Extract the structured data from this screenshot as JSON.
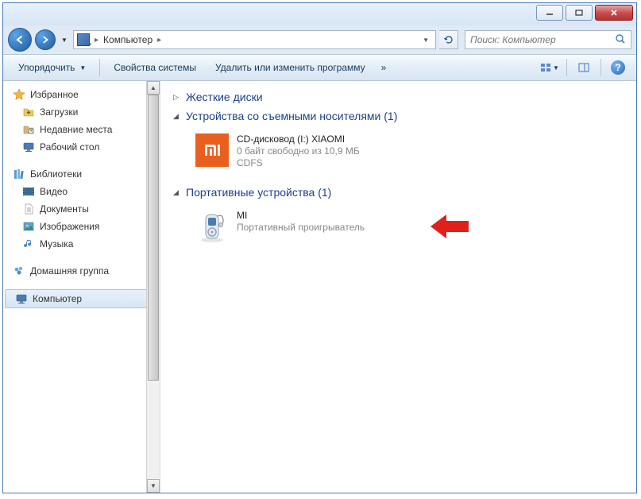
{
  "titlebar": {
    "minimize": "Minimize",
    "maximize": "Maximize",
    "close": "Close"
  },
  "navbar": {
    "back": "←",
    "forward": "→",
    "location": "Компьютер",
    "refresh": "↻"
  },
  "search": {
    "placeholder": "Поиск: Компьютер"
  },
  "toolbar": {
    "organize": "Упорядочить",
    "properties": "Свойства системы",
    "uninstall": "Удалить или изменить программу",
    "overflow": "»"
  },
  "sidebar": {
    "favorites": {
      "label": "Избранное",
      "items": [
        {
          "label": "Загрузки",
          "icon": "downloads"
        },
        {
          "label": "Недавние места",
          "icon": "recent"
        },
        {
          "label": "Рабочий стол",
          "icon": "desktop"
        }
      ]
    },
    "libraries": {
      "label": "Библиотеки",
      "items": [
        {
          "label": "Видео",
          "icon": "video"
        },
        {
          "label": "Документы",
          "icon": "documents"
        },
        {
          "label": "Изображения",
          "icon": "pictures"
        },
        {
          "label": "Музыка",
          "icon": "music"
        }
      ]
    },
    "homegroup": {
      "label": "Домашняя группа"
    },
    "computer": {
      "label": "Компьютер"
    }
  },
  "main": {
    "groups": [
      {
        "title": "Жесткие диски",
        "collapsed": true,
        "items": []
      },
      {
        "title": "Устройства со съемными носителями (1)",
        "collapsed": false,
        "items": [
          {
            "icon": "xiaomi",
            "name": "CD-дисковод (I:) XIAOMI",
            "detail1": "0 байт свободно из 10,9 МБ",
            "detail2": "CDFS"
          }
        ]
      },
      {
        "title": "Портативные устройства (1)",
        "collapsed": false,
        "items": [
          {
            "icon": "player",
            "name": "MI",
            "detail1": "Портативный проигрыватель",
            "highlighted": true
          }
        ]
      }
    ]
  }
}
